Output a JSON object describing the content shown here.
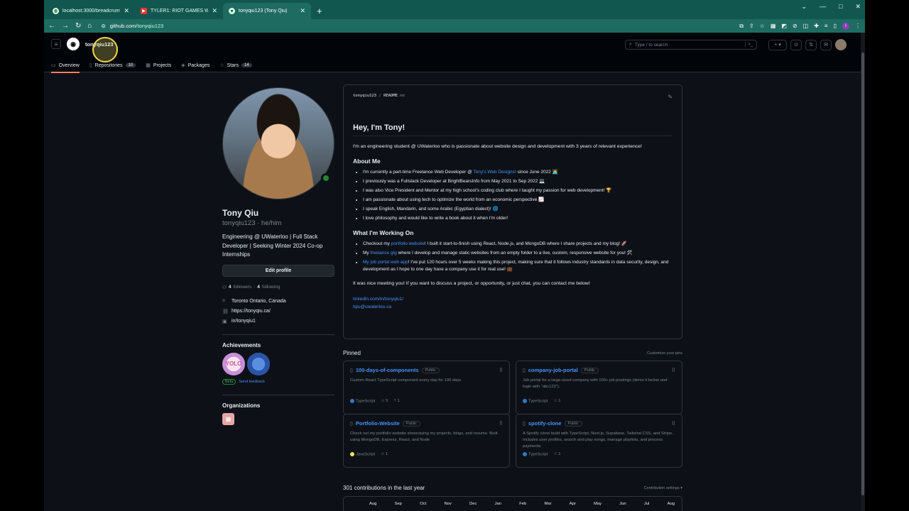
{
  "browser": {
    "tabs": [
      {
        "title": "localhost:3000/breadcrumb",
        "active": false
      },
      {
        "title": "TYLER1: RIOT GAMES WHAT ARE",
        "active": false
      },
      {
        "title": "tonyqiu123 (Tony Qiu)",
        "active": true
      }
    ],
    "new_tab": "+",
    "url_host": "github.com",
    "url_path": "/tonyqiu123"
  },
  "header": {
    "username": "tonyqiu123",
    "search_placeholder": "Type / to search",
    "nav": [
      {
        "label": "Overview",
        "icon": "book-icon"
      },
      {
        "label": "Repositories",
        "icon": "repo-icon",
        "count": "10"
      },
      {
        "label": "Projects",
        "icon": "table-icon"
      },
      {
        "label": "Packages",
        "icon": "package-icon"
      },
      {
        "label": "Stars",
        "icon": "star-icon",
        "count": "14"
      }
    ]
  },
  "profile": {
    "name": "Tony Qiu",
    "login": "tonyqiu123 · he/him",
    "bio": "Engineering @ UWaterloo | Full Stack Developer | Seeking Winter 2024 Co-op Internships",
    "edit_label": "Edit profile",
    "followers": "4",
    "followers_label": "followers",
    "following": "4",
    "following_label": "following",
    "location": "Toronto Ontario, Canada",
    "website": "https://tonyqiu.ca/",
    "linkedin": "in/tonyqiu1",
    "achievements_title": "Achievements",
    "beta_label": "Beta",
    "feedback_label": "Send feedback",
    "organizations_title": "Organizations"
  },
  "readme": {
    "owner": "tonyqiu123",
    "file": "README",
    "ext": ".md",
    "heading": "Hey, I'm Tony!",
    "intro": "I'm an engineering student @ UWaterloo who is passionate about website design and development with 3 years of relevant experience!",
    "about_title": "About Me",
    "about_items": [
      {
        "pre": "I'm currently a part-time Freelance Web Developer @ ",
        "link": "Tony's Web Designs!",
        "post": " since June 2022 🧑‍💻"
      },
      {
        "pre": "I previously was a Fullstack Developer at BrightBearsInfo from May 2021 to Sep 2022 💻",
        "link": "",
        "post": ""
      },
      {
        "pre": "I was also Vice President and Mentor at my high school's coding club where I taught my passion for web development! 🏆",
        "link": "",
        "post": ""
      },
      {
        "pre": "I am passionate about using tech to optimize the world from an economic perspective 📈",
        "link": "",
        "post": ""
      },
      {
        "pre": "I speak English, Mandarin, and some Arabic (Egyptian dialect)! 🌐",
        "link": "",
        "post": ""
      },
      {
        "pre": "I love philosophy and would like to write a book about it when I'm older!",
        "link": "",
        "post": ""
      }
    ],
    "working_title": "What I'm Working On",
    "working_items": [
      {
        "pre": "Checkout my ",
        "link": "portfolio website",
        "post": "! I built it start-to-finish using React, Node.js, and MongoDB where I share projects and my blog! 🚀"
      },
      {
        "pre": "My ",
        "link": "freelance gig",
        "post": " where I develop and manage static websites from an empty folder to a live, custom, responsive website for you! 🛠️"
      },
      {
        "pre": "",
        "link": "My job portal web app",
        "post": "! I've put 120 hours over 5 weeks making this project, making sure that it follows industry standards in data security, design, and development as I hope to one day have a company use it for real use! 💼"
      }
    ],
    "outro": "It was nice meeting you! If you want to discuss a project, or opportunity, or just chat, you can contact me below!",
    "linkedin_link": "linkedin.com/in/tonyqiu1/",
    "email_link": "tqiu@uwaterloo.ca"
  },
  "pinned": {
    "title": "Pinned",
    "customize": "Customize your pins",
    "public_label": "Public",
    "repos": [
      {
        "name": "100-days-of-components",
        "desc": "Custom React TypeScript component every day for 100 days",
        "lang": "TypeScript",
        "lang_color": "#3178c6",
        "stars": "5",
        "forks": "1"
      },
      {
        "name": "company-job-portal",
        "desc": "Job portal for a large-sized company with 100+ job postings (demo it below and login with \"abc123\").",
        "lang": "TypeScript",
        "lang_color": "#3178c6",
        "stars": "1",
        "forks": ""
      },
      {
        "name": "Portfolio-Website",
        "desc": "Check out my portfolio website showcasing my projects, blogs, and resume. Built using MongoDB, Express, React, and Node",
        "lang": "JavaScript",
        "lang_color": "#f1e05a",
        "stars": "1",
        "forks": ""
      },
      {
        "name": "spotify-clone",
        "desc": "A Spotify clone build with TypeScript, Next.js, Supabase, Tailwind CSS, and Stripe. Includes user profiles, search and play songs, manage playlists, and process payments.",
        "lang": "TypeScript",
        "lang_color": "#3178c6",
        "stars": "1",
        "forks": ""
      }
    ]
  },
  "contributions": {
    "title": "301 contributions in the last year",
    "settings": "Contribution settings ▾",
    "months": [
      "Aug",
      "Sep",
      "Oct",
      "Nov",
      "Dec",
      "Jan",
      "Feb",
      "Mar",
      "Apr",
      "May",
      "Jun",
      "Jul",
      "Aug"
    ]
  }
}
